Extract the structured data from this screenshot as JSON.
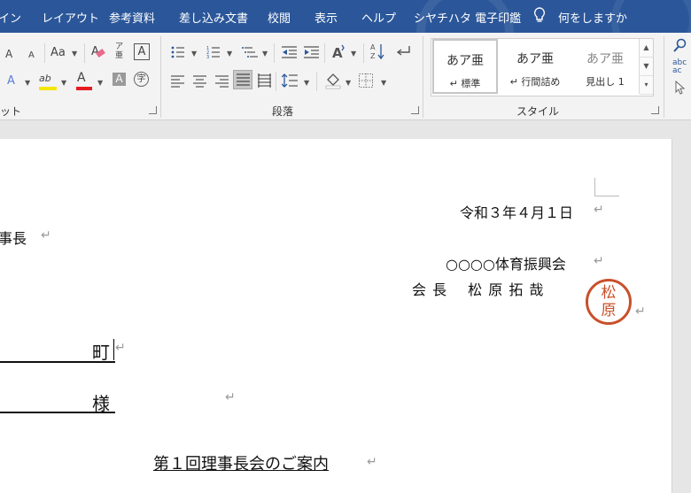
{
  "menu": {
    "tabs": [
      "イン",
      "レイアウト",
      "参考資料",
      "差し込み文書",
      "校閲",
      "表示",
      "ヘルプ",
      "シヤチハタ 電子印鑑"
    ],
    "tell_me": "何をしますか"
  },
  "ribbon": {
    "font_group_label": "ット",
    "paragraph_group_label": "段落",
    "styles_group_label": "スタイル",
    "font": {
      "grow": "A",
      "shrink": "A",
      "change_case": "Aa",
      "phonetic": "ア",
      "enclose": "A",
      "text_effects": "A",
      "highlight": "ab",
      "font_color": "A",
      "char_shading": "A",
      "enclosed_char": "字",
      "highlight_color": "#f5e600",
      "font_color_bar": "#e51c23"
    },
    "styles": [
      {
        "sample": "あア亜",
        "name": "↵ 標準"
      },
      {
        "sample": "あア亜",
        "name": "↵ 行間詰め"
      },
      {
        "sample": "あア亜",
        "name": "見出し 1"
      }
    ],
    "side": {
      "replace": "abc\nac"
    }
  },
  "document": {
    "date": "令和３年４月１日",
    "recipient_title": "事長",
    "org": "○○○○体育振興会",
    "sender": "会 長　 松 原 拓 哉",
    "town_suffix": "町",
    "honorific": "様",
    "heading": "第１回理事長会のご案内",
    "seal_chars": [
      "松",
      "原"
    ],
    "seal_color": "#c8502a",
    "para_mark": "↵"
  }
}
